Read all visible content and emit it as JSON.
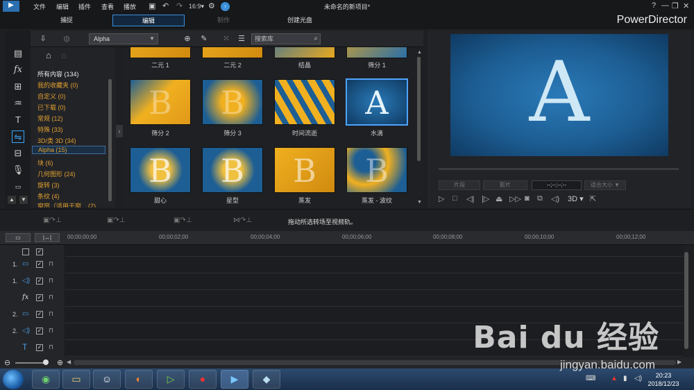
{
  "menu": [
    "文件",
    "编辑",
    "插件",
    "查看",
    "播放"
  ],
  "doc_title": "未命名的新项目*",
  "window_controls": {
    "help": "?",
    "minimize": "—",
    "restore": "❐",
    "close": "✕"
  },
  "modes": {
    "capture": "捕捉",
    "edit": "编辑",
    "produce": "制作",
    "disc": "创建光盘"
  },
  "brand": "PowerDirector",
  "library": {
    "filter_value": "Alpha",
    "search_placeholder": "搜索库",
    "categories": [
      {
        "label": "所有内容 (134)"
      },
      {
        "label": "我的收藏夹 (0)"
      },
      {
        "label": "自定义 (0)"
      },
      {
        "label": "已下载 (0)"
      },
      {
        "label": "常规 (12)"
      },
      {
        "label": "特殊 (33)"
      },
      {
        "label": "3D/类 3D (34)"
      },
      {
        "label": "Alpha (15)"
      },
      {
        "label": "块 (6)"
      },
      {
        "label": "几何图形 (24)"
      },
      {
        "label": "旋转 (3)"
      },
      {
        "label": "条纹 (4)"
      },
      {
        "label": "窗帘（适用于窗... (2)"
      }
    ],
    "transitions_top": [
      "二元 1",
      "二元 2",
      "结晶",
      "筛分 1"
    ],
    "transitions": [
      "筛分 2",
      "筛分 3",
      "时间流逝",
      "水滴",
      "甜心",
      "星型",
      "蒸发",
      "蒸发 - 波纹"
    ]
  },
  "preview": {
    "letter": "A",
    "timecode": "--;--;--;--",
    "btn_a": "片段",
    "btn_b": "影片",
    "btn_c": "适合大小 ▼",
    "mode_3d": "3D ▾"
  },
  "edit_hint": "拖动所选转场至视频轨。",
  "ruler": [
    "00;00;00;00",
    "00;00;02;00",
    "00;00;04;00",
    "00;00;06;00",
    "00;00;08;00",
    "00;00;10;00",
    "00;00;12;00"
  ],
  "tracks": [
    {
      "num": "",
      "icon": "",
      "type": "header"
    },
    {
      "num": "1.",
      "icon": "▭",
      "type": "video"
    },
    {
      "num": "1.",
      "icon": "◁)",
      "type": "audio"
    },
    {
      "num": "",
      "icon": "fx",
      "type": "fx"
    },
    {
      "num": "2.",
      "icon": "▭",
      "type": "video"
    },
    {
      "num": "2.",
      "icon": "◁)",
      "type": "audio"
    },
    {
      "num": "",
      "icon": "T",
      "type": "title"
    }
  ],
  "clock": {
    "time": "20:23",
    "date": "2018/12/23"
  },
  "watermark": {
    "brand": "Bai du 经验",
    "url": "jingyan.baidu.com"
  },
  "colors": {
    "accent": "#3a8fd8",
    "category": "#e0a030"
  }
}
